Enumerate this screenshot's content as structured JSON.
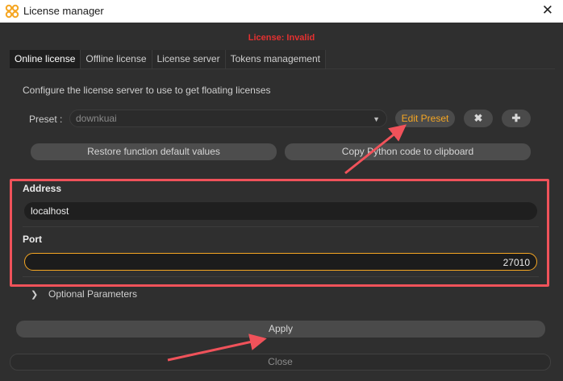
{
  "window": {
    "title": "License manager",
    "close_glyph": "✕",
    "icon": "license-manager-app-icon"
  },
  "status": {
    "text": "License: Invalid",
    "color": "#e53030"
  },
  "tabs": [
    {
      "label": "Online license",
      "active": true
    },
    {
      "label": "Offline license",
      "active": false
    },
    {
      "label": "License server",
      "active": false
    },
    {
      "label": "Tokens management",
      "active": false
    }
  ],
  "server": {
    "description": "Configure the license server to use to get floating licenses",
    "preset_label": "Preset :",
    "preset_value": "downkuai",
    "edit_preset_label": "Edit Preset",
    "delete_glyph": "✖",
    "add_glyph": "✚",
    "restore_label": "Restore function default values",
    "copy_label": "Copy Python code to clipboard"
  },
  "address": {
    "label": "Address",
    "value": "localhost"
  },
  "port": {
    "label": "Port",
    "value": "27010"
  },
  "optional": {
    "chevron_glyph": "❯",
    "label": "Optional Parameters"
  },
  "actions": {
    "apply_label": "Apply",
    "close_label": "Close"
  },
  "colors": {
    "accent": "#f5a623",
    "annotation": "#f0525a",
    "background": "#2f2f2f"
  }
}
